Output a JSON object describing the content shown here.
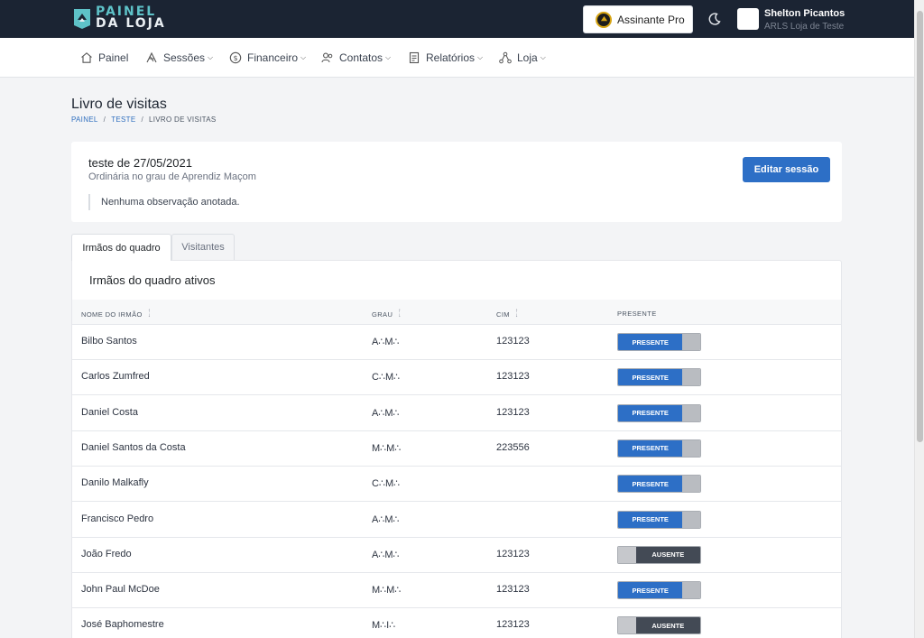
{
  "header": {
    "logo_line1": "PAINEL",
    "logo_line2": "DA LOJA",
    "pro_label": "Assinante Pro",
    "user_name": "Shelton Picantos",
    "user_lodge": "ARLS Loja de Teste"
  },
  "nav": {
    "items": [
      {
        "label": "Painel",
        "icon": "home-icon"
      },
      {
        "label": "Sessões",
        "icon": "sessions-icon"
      },
      {
        "label": "Financeiro",
        "icon": "dollar-icon"
      },
      {
        "label": "Contatos",
        "icon": "users-icon"
      },
      {
        "label": "Relatórios",
        "icon": "report-icon"
      },
      {
        "label": "Loja",
        "icon": "network-icon"
      }
    ]
  },
  "page": {
    "title": "Livro de visitas",
    "breadcrumb": [
      "PAINEL",
      "TESTE",
      "LIVRO DE VISITAS"
    ]
  },
  "session": {
    "title": "teste de 27/05/2021",
    "subtitle": "Ordinária no grau de Aprendiz Maçom",
    "note": "Nenhuma observação anotada.",
    "edit_label": "Editar sessão"
  },
  "tabs": [
    "Irmãos do quadro",
    "Visitantes"
  ],
  "table": {
    "title": "Irmãos do quadro ativos",
    "columns": [
      "NOME DO IRMÃO",
      "GRAU",
      "CIM",
      "PRESENTE"
    ],
    "rows": [
      {
        "name": "Bilbo Santos",
        "grau": "A∴M∴",
        "cim": "123123",
        "status": "PRESENTE"
      },
      {
        "name": "Carlos Zumfred",
        "grau": "C∴M∴",
        "cim": "123123",
        "status": "PRESENTE"
      },
      {
        "name": "Daniel Costa",
        "grau": "A∴M∴",
        "cim": "123123",
        "status": "PRESENTE"
      },
      {
        "name": "Daniel Santos da Costa",
        "grau": "M∴M∴",
        "cim": "223556",
        "status": "PRESENTE"
      },
      {
        "name": "Danilo Malkafly",
        "grau": "C∴M∴",
        "cim": "",
        "status": "PRESENTE"
      },
      {
        "name": "Francisco Pedro",
        "grau": "A∴M∴",
        "cim": "",
        "status": "PRESENTE"
      },
      {
        "name": "João Fredo",
        "grau": "A∴M∴",
        "cim": "123123",
        "status": "AUSENTE"
      },
      {
        "name": "John Paul McDoe",
        "grau": "M∴M∴",
        "cim": "123123",
        "status": "PRESENTE"
      },
      {
        "name": "José Baphomestre",
        "grau": "M∴I∴",
        "cim": "123123",
        "status": "AUSENTE"
      }
    ]
  },
  "colors": {
    "topbar": "#1b2433",
    "accent": "#2d6fc6",
    "absent": "#434a55",
    "logo_teal": "#5ec2c8"
  }
}
